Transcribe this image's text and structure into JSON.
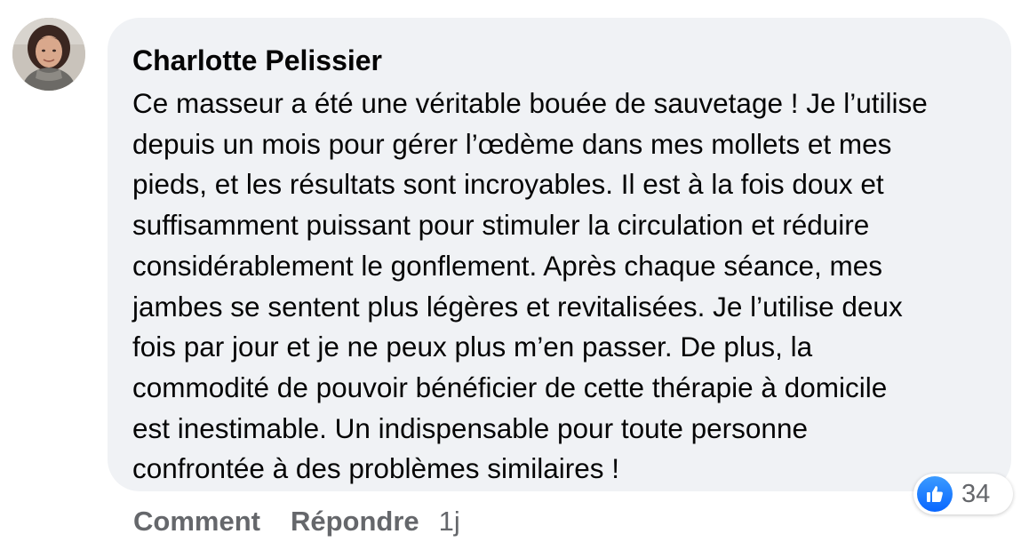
{
  "comment": {
    "author": "Charlotte Pelissier",
    "lines": [
      "Ce masseur a été une véritable bouée de sauvetage ! Je l’utilise",
      "depuis un mois pour gérer l’œdème dans mes mollets et mes",
      "pieds, et les résultats sont incroyables. Il est à la fois doux et",
      "suffisamment puissant pour stimuler la circulation et réduire",
      "considérablement le gonflement. Après chaque séance, mes",
      "jambes se sentent plus légères et revitalisées. Je l’utilise deux",
      "fois par jour et je ne peux plus m’en passer. De plus, la",
      "commodité de pouvoir bénéficier de cette thérapie à domicile",
      "est inestimable. Un indispensable pour toute personne",
      "confrontée à des problèmes similaires !"
    ],
    "reactions": {
      "icon": "like-icon",
      "count": "34",
      "color": "#0866ff"
    }
  },
  "actions": {
    "comment_label": "Comment",
    "reply_label": "Répondre",
    "timestamp": "1j"
  },
  "colors": {
    "bubble_bg": "#f0f2f5",
    "text": "#050505",
    "secondary": "#65676b"
  }
}
